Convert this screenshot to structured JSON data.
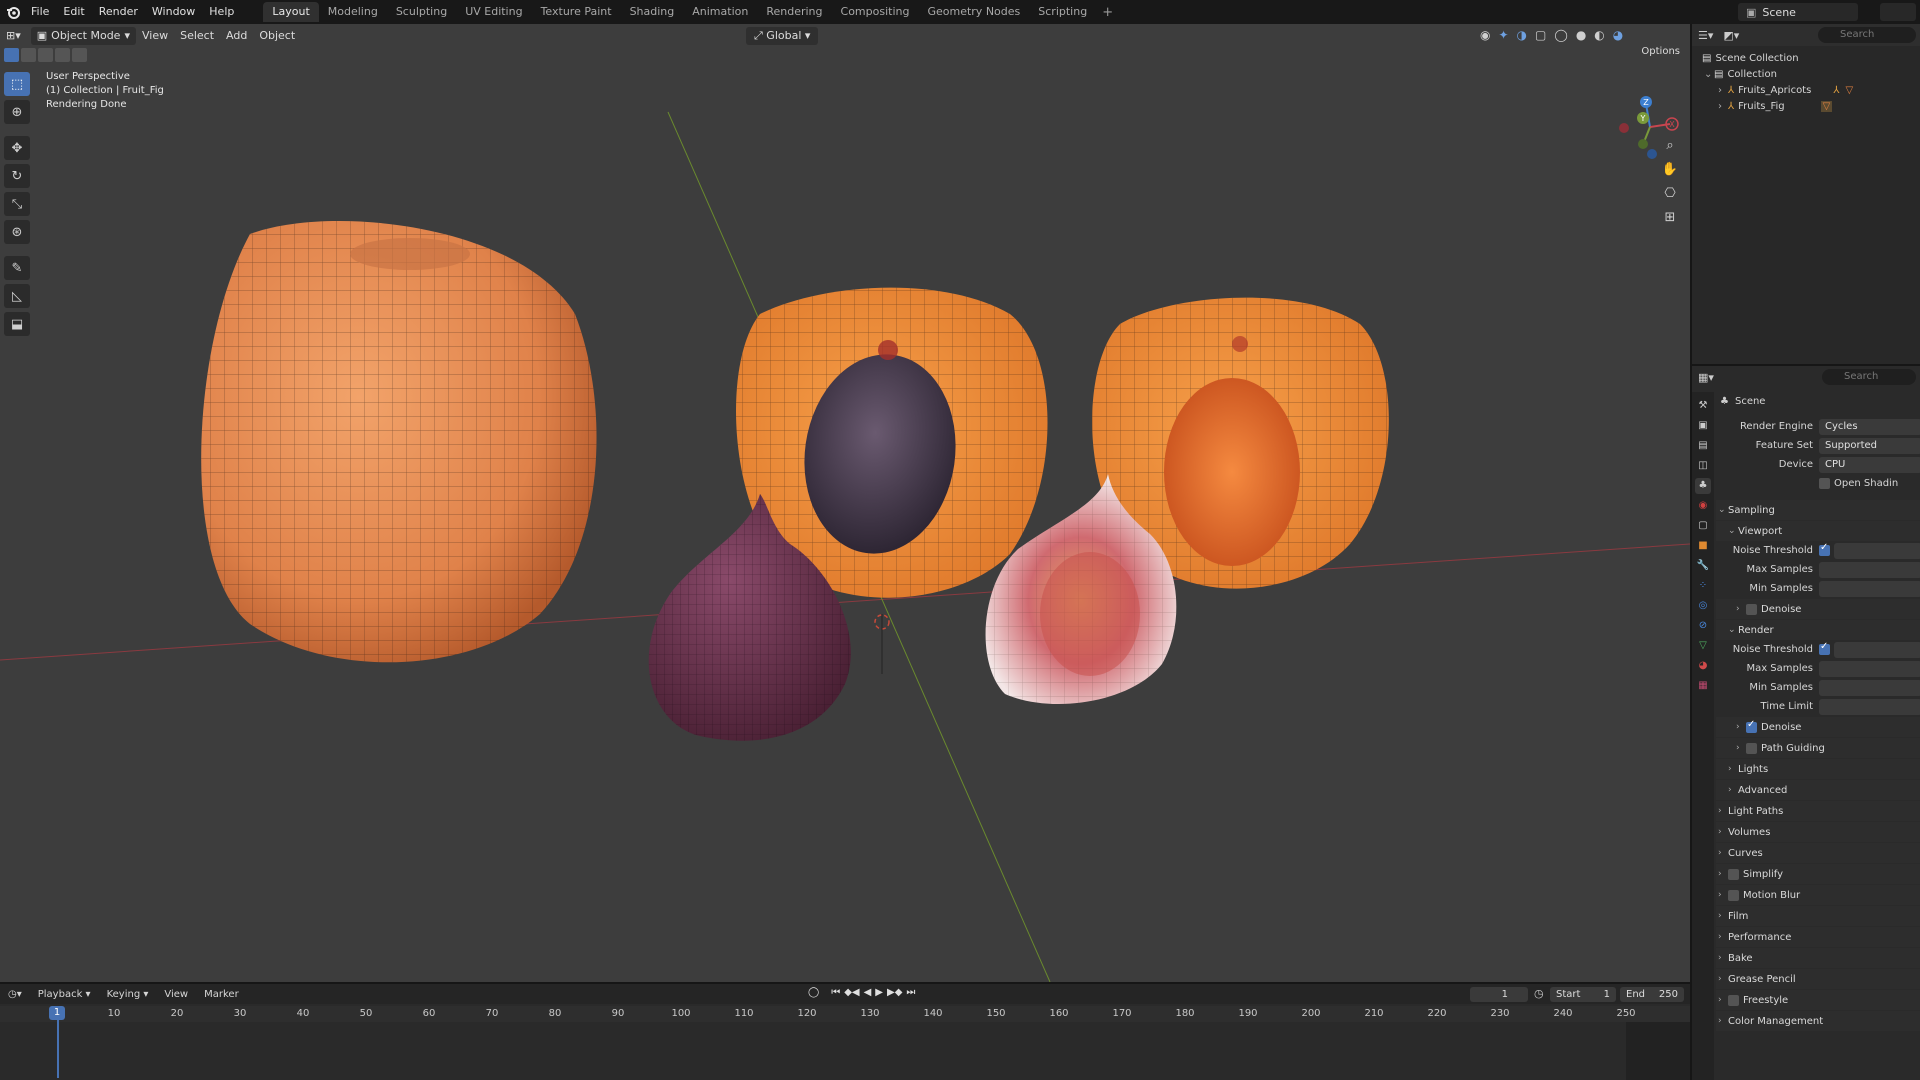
{
  "topbar": {
    "menus": [
      "File",
      "Edit",
      "Render",
      "Window",
      "Help"
    ],
    "workspaces": [
      "Layout",
      "Modeling",
      "Sculpting",
      "UV Editing",
      "Texture Paint",
      "Shading",
      "Animation",
      "Rendering",
      "Compositing",
      "Geometry Nodes",
      "Scripting"
    ],
    "active_workspace": "Layout",
    "add_tab": "+",
    "scene_name": "Scene"
  },
  "viewport": {
    "mode": "Object Mode",
    "menus": [
      "View",
      "Select",
      "Add",
      "Object"
    ],
    "orientation": "Global",
    "options_label": "Options",
    "overlay": {
      "line1": "User Perspective",
      "line2": "(1) Collection | Fruit_Fig",
      "line3": "Rendering Done"
    },
    "gizmo_axes": {
      "x": "X",
      "y": "Y",
      "z": "Z"
    },
    "colors": {
      "background": "#3d3d3d",
      "x_axis": "#c8454f",
      "y_axis": "#7a9a3a",
      "z_axis": "#3d7fd0",
      "active": "#4772b3"
    }
  },
  "outliner": {
    "search_placeholder": "Search",
    "items": [
      {
        "label": "Scene Collection",
        "icon": "collection-white-icon"
      },
      {
        "label": "Collection",
        "icon": "collection-icon"
      },
      {
        "label": "Fruits_Apricots",
        "icon": "armature-icon"
      },
      {
        "label": "Fruits_Fig",
        "icon": "armature-icon"
      }
    ]
  },
  "properties": {
    "search_placeholder": "Search",
    "context": "Scene",
    "render_engine_label": "Render Engine",
    "render_engine": "Cycles",
    "feature_set_label": "Feature Set",
    "feature_set": "Supported",
    "device_label": "Device",
    "device": "CPU",
    "open_shading": "Open Shadin",
    "sampling": "Sampling",
    "viewport_section": "Viewport",
    "noise_threshold": "Noise Threshold",
    "max_samples": "Max Samples",
    "min_samples": "Min Samples",
    "denoise": "Denoise",
    "render_section": "Render",
    "time_limit": "Time Limit",
    "path_guiding": "Path Guiding",
    "lights": "Lights",
    "advanced": "Advanced",
    "sections": [
      "Light Paths",
      "Volumes",
      "Curves",
      "Simplify",
      "Motion Blur",
      "Film",
      "Performance",
      "Bake",
      "Grease Pencil",
      "Freestyle",
      "Color Management"
    ]
  },
  "timeline": {
    "menus": [
      "Playback",
      "Keying",
      "View",
      "Marker"
    ],
    "current_frame": "1",
    "start_label": "Start",
    "start": "1",
    "end_label": "End",
    "end": "250",
    "ruler": [
      "1",
      "10",
      "20",
      "30",
      "40",
      "50",
      "60",
      "70",
      "80",
      "90",
      "100",
      "110",
      "120",
      "130",
      "140",
      "150",
      "160",
      "170",
      "180",
      "190",
      "200",
      "210",
      "220",
      "230",
      "240",
      "250"
    ]
  }
}
